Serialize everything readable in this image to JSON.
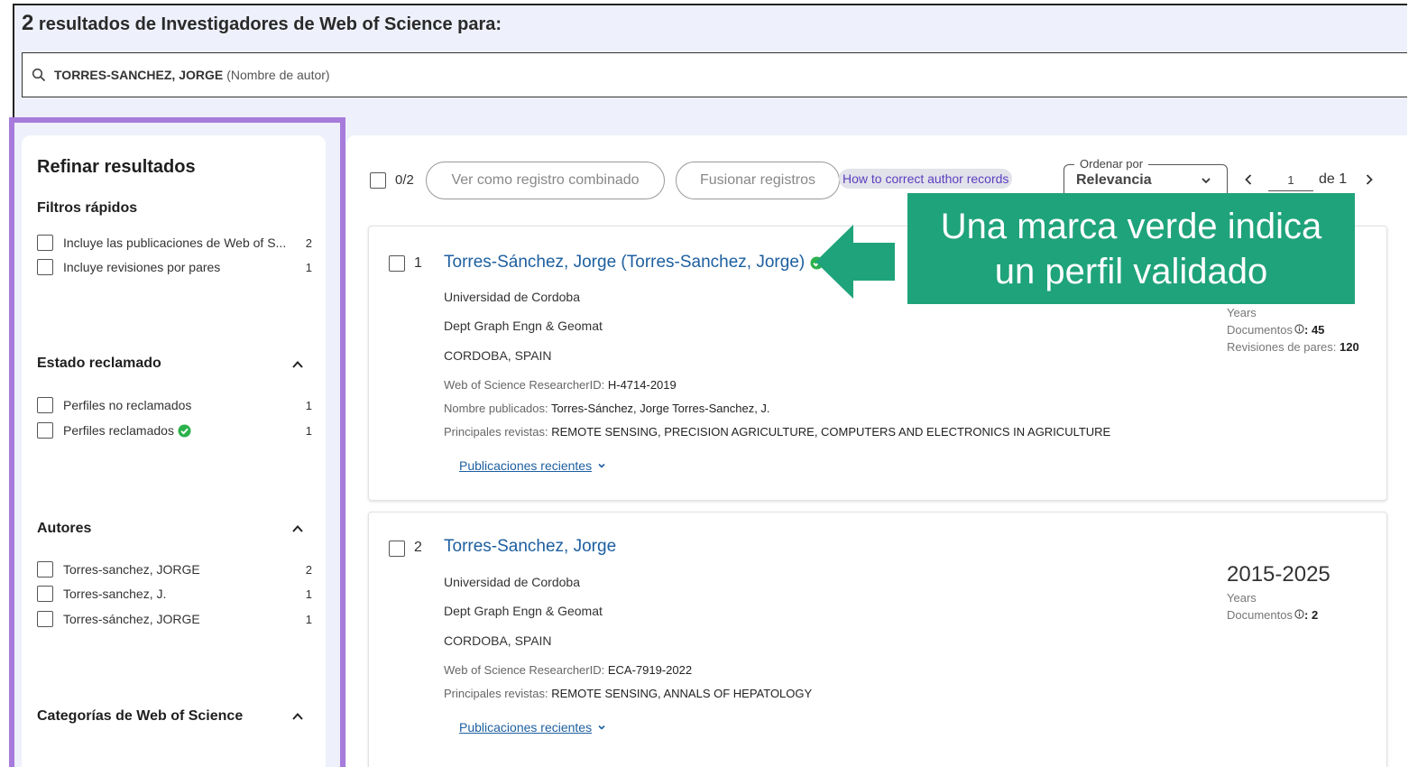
{
  "header": {
    "results_count": "2",
    "results_text": "resultados de Investigadores de Web of Science para:",
    "search_query": "TORRES-SANCHEZ, JORGE",
    "search_type": "(Nombre de autor)"
  },
  "sidebar": {
    "title": "Refinar resultados",
    "quick_filters": {
      "title": "Filtros rápidos",
      "items": [
        {
          "label": "Incluye las publicaciones de Web of S...",
          "count": "2"
        },
        {
          "label": "Incluye revisiones por pares",
          "count": "1"
        }
      ]
    },
    "claim_status": {
      "title": "Estado reclamado",
      "items": [
        {
          "label": "Perfiles no reclamados",
          "count": "1"
        },
        {
          "label": "Perfiles reclamados",
          "count": "1"
        }
      ]
    },
    "authors": {
      "title": "Autores",
      "items": [
        {
          "label": "Torres-sanchez, JORGE",
          "count": "2"
        },
        {
          "label": "Torres-sanchez, J.",
          "count": "1"
        },
        {
          "label": "Torres-sánchez, JORGE",
          "count": "1"
        }
      ]
    },
    "categories": {
      "title": "Categorías de Web of Science"
    }
  },
  "toolbar": {
    "selected": "0/2",
    "combined_label": "Ver como registro combinado",
    "merge_label": "Fusionar registros",
    "help_link": "How to correct author records",
    "sort_legend": "Ordenar por",
    "sort_value": "Relevancia",
    "page_current": "1",
    "page_of": "de 1"
  },
  "records": [
    {
      "num": "1",
      "name": "Torres-Sánchez, Jorge (Torres-Sanchez, Jorge)",
      "org": "Universidad de Cordoba",
      "dept": "Dept Graph Engn & Geomat",
      "location": "CORDOBA, SPAIN",
      "rid_label": "Web of Science ResearcherID:",
      "rid_value": "H-4714-2019",
      "pub_names_label": "Nombre publicados:",
      "pub_names_value": "Torres-Sánchez, Jorge   Torres-Sanchez, J.",
      "journals_label": "Principales revistas:",
      "journals_value": "REMOTE SENSING, PRECISION AGRICULTURE, COMPUTERS AND ELECTRONICS IN AGRICULTURE",
      "recent_link": "Publicaciones recientes",
      "years_label": "Years",
      "docs_label": "Documentos",
      "docs_value": "45",
      "reviews_label": "Revisiones de pares:",
      "reviews_value": "120"
    },
    {
      "num": "2",
      "name": "Torres-Sanchez, Jorge",
      "org": "Universidad de Cordoba",
      "dept": "Dept Graph Engn & Geomat",
      "location": "CORDOBA, SPAIN",
      "rid_label": "Web of Science ResearcherID:",
      "rid_value": "ECA-7919-2022",
      "journals_label": "Principales revistas:",
      "journals_value": "REMOTE SENSING, ANNALS OF HEPATOLOGY",
      "recent_link": "Publicaciones recientes",
      "years_value": "2015-2025",
      "years_label": "Years",
      "docs_label": "Documentos",
      "docs_value": "2"
    }
  ],
  "callout": {
    "line1": "Una marca verde indica",
    "line2": "un perfil validado"
  },
  "colors": {
    "callout_green": "#1fa37a",
    "highlight_purple": "#a77bdc",
    "link_blue": "#1d5fa0",
    "verified_green": "#2bb24c"
  },
  "icons": {
    "search": "search-icon",
    "verified": "verified-check-icon",
    "chevron_up": "chevron-up-icon",
    "chevron_down": "chevron-down-icon",
    "prev": "chevron-left-icon",
    "next": "chevron-right-icon",
    "info": "info-icon",
    "arrow": "arrow-left-icon"
  }
}
